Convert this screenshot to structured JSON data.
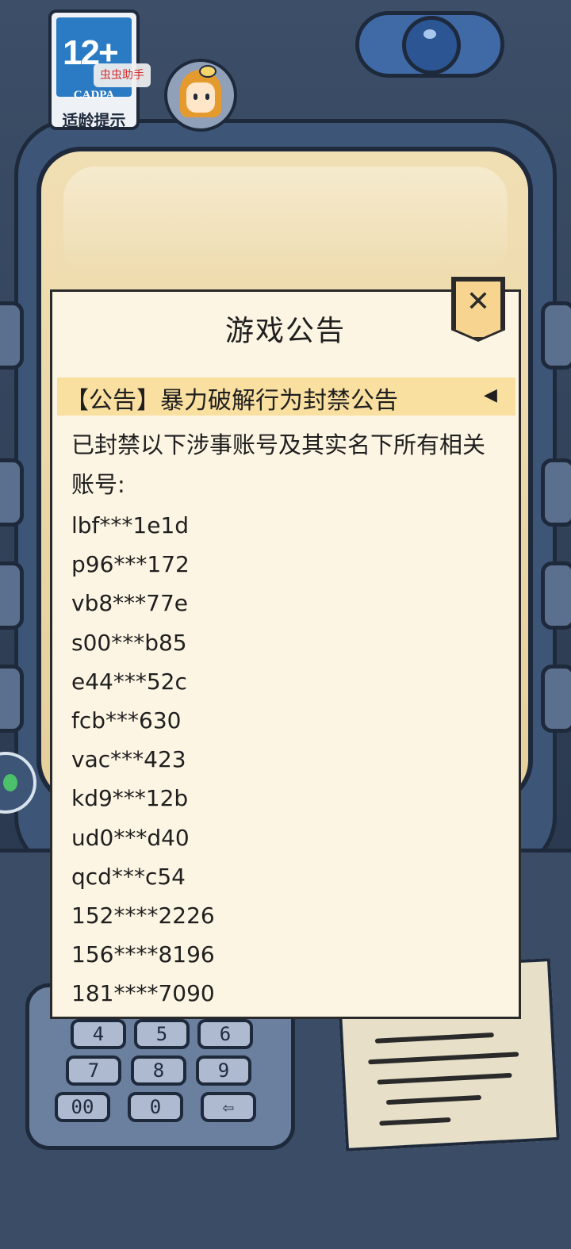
{
  "age_rating": {
    "number": "12+",
    "org": "CADPA",
    "caption": "适龄提示"
  },
  "assist_tag": "虫虫助手",
  "dialog": {
    "title": "游戏公告",
    "close_symbol": "✕",
    "notice": {
      "title": "【公告】暴力破解行为封禁公告",
      "collapse_symbol": "◀",
      "intro": "已封禁以下涉事账号及其实名下所有相关账号:",
      "accounts": [
        "lbf***1e1d",
        "p96***172",
        "vb8***77e",
        "s00***b85",
        "e44***52c",
        "fcb***630",
        "vac***423",
        "kd9***12b",
        "ud0***d40",
        "qcd***c54",
        "152****2226",
        "156****8196",
        "181****7090"
      ]
    }
  },
  "keypad": {
    "keys": [
      "4",
      "5",
      "6",
      "7",
      "8",
      "9",
      "00",
      "0",
      "⇦"
    ]
  },
  "colors": {
    "dialog_bg": "#fdf5e4",
    "notice_header_bg": "#f9dfa0",
    "close_button_bg": "#f7d591",
    "rating_blue": "#2a7bc3",
    "assist_tag_red": "#d62b2b"
  }
}
